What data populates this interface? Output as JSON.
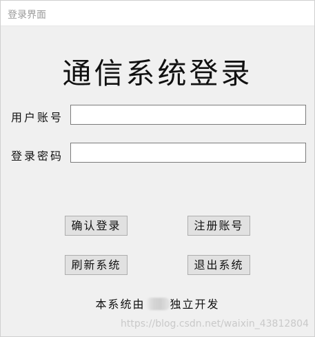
{
  "window": {
    "title": "登录界面"
  },
  "header": {
    "title": "通信系统登录"
  },
  "form": {
    "account_label": "用户账号",
    "account_value": "",
    "password_label": "登录密码",
    "password_value": ""
  },
  "buttons": {
    "confirm_login": "确认登录",
    "register": "注册账号",
    "refresh": "刷新系统",
    "exit": "退出系统"
  },
  "footer": {
    "text_before": "本系统由",
    "text_after": "独立开发"
  },
  "watermark": {
    "text": "https://blog.csdn.net/waixin_43812804"
  }
}
